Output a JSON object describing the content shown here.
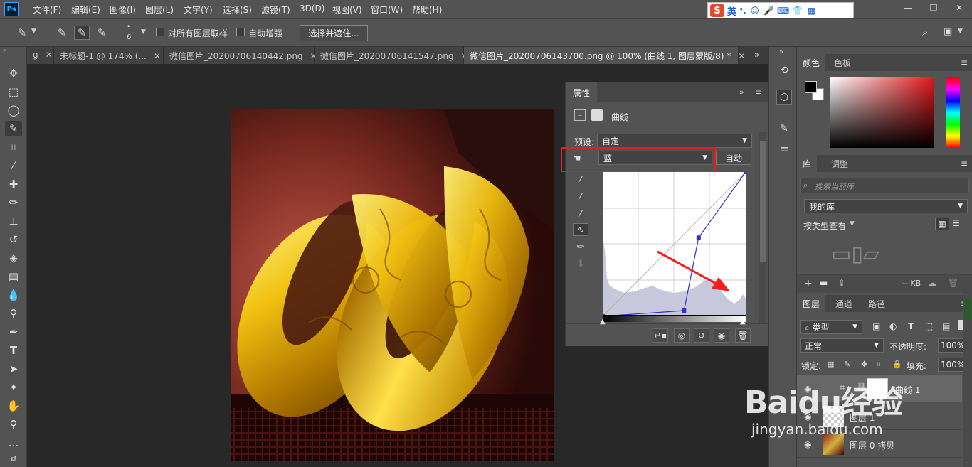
{
  "app": {
    "logo": "Ps"
  },
  "menu": [
    "文件(F)",
    "编辑(E)",
    "图像(I)",
    "图层(L)",
    "文字(Y)",
    "选择(S)",
    "滤镜(T)",
    "3D(D)",
    "视图(V)",
    "窗口(W)",
    "帮助(H)"
  ],
  "ime": {
    "logo": "S",
    "mode": "英",
    "punct": "°,"
  },
  "options": {
    "brush_size": "6",
    "sample_all_layers": "对所有图层取样",
    "auto_enhance": "自动增强",
    "select_mask_button": "选择并遮住..."
  },
  "tabs": [
    {
      "label": "g",
      "active": false
    },
    {
      "label": "未标题-1 @ 174% (...",
      "active": false
    },
    {
      "label": "微信图片_20200706140442.png",
      "active": false
    },
    {
      "label": "微信图片_20200706141547.png",
      "active": false
    },
    {
      "label": "微信图片_20200706143700.png @ 100% (曲线 1, 图层蒙版/8) *",
      "active": true
    }
  ],
  "properties": {
    "tab": "属性",
    "type": "曲线",
    "preset_label": "预设:",
    "preset_value": "自定",
    "channel_value": "蓝",
    "auto_button": "自动"
  },
  "curve": {
    "channel_color": "#3030d0",
    "points": [
      [
        0,
        0
      ],
      [
        145,
        10
      ],
      [
        171,
        139
      ],
      [
        255,
        255
      ]
    ]
  },
  "panels": {
    "color_tab": "颜色",
    "swatches_tab": "色板",
    "library_tab": "库",
    "adjust_tab": "调整",
    "search_placeholder": "搜索当前库",
    "my_library": "我的库",
    "view_by_type": "按类型查看",
    "kb_label": "-- KB",
    "layers_tab": "图层",
    "channels_tab": "通道",
    "paths_tab": "路径",
    "filter_kind": "类型",
    "blend_mode": "正常",
    "opacity_label": "不透明度:",
    "opacity_value": "100%",
    "lock_label": "锁定:",
    "fill_label": "填充:",
    "fill_value": "100%"
  },
  "layers": [
    {
      "name": "曲线 1"
    },
    {
      "name": "图层 1"
    },
    {
      "name": "图层 0 拷贝"
    }
  ],
  "watermark": {
    "brand": "Baidu经验",
    "url": "jingyan.baidu.com"
  }
}
